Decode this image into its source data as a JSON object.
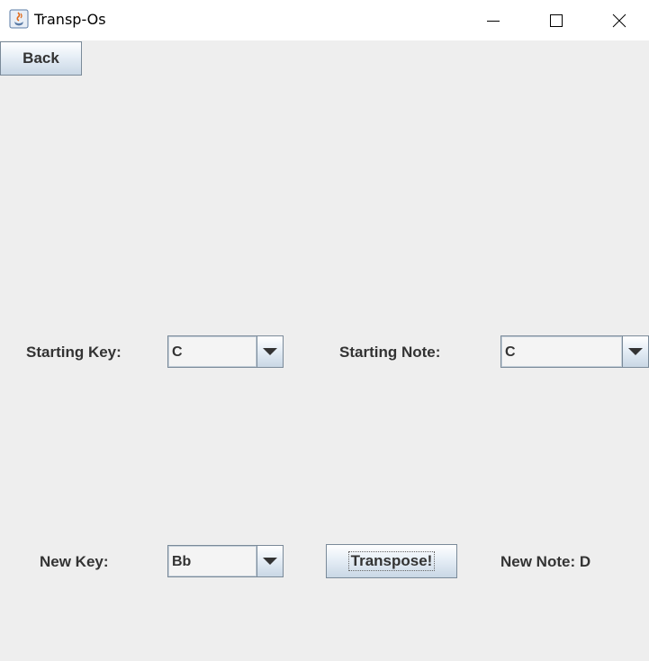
{
  "window": {
    "title": "Transp-Os"
  },
  "toolbar": {
    "back_label": "Back"
  },
  "form": {
    "starting_key_label": "Starting Key:",
    "starting_key_value": "C",
    "starting_note_label": "Starting Note:",
    "starting_note_value": "C",
    "new_key_label": "New Key:",
    "new_key_value": "Bb",
    "transpose_label": "Transpose!",
    "new_note_label": "New Note: D"
  },
  "icons": {
    "app": "java-coffee-icon",
    "minimize": "minimize-icon",
    "maximize": "maximize-icon",
    "close": "close-icon",
    "dropdown": "chevron-down-icon"
  }
}
